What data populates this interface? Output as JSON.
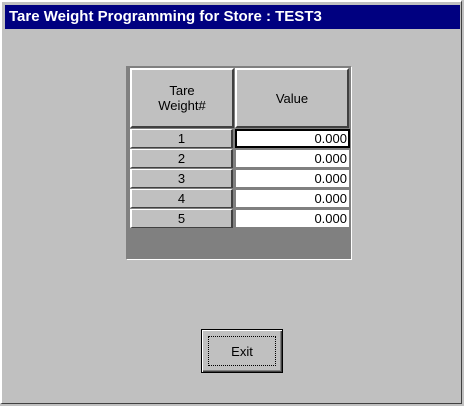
{
  "window": {
    "title": "Tare Weight Programming for Store :  TEST3"
  },
  "grid": {
    "columns": [
      "Tare\nWeight#",
      "Value"
    ],
    "rows": [
      {
        "num": "1",
        "value": "0.000"
      },
      {
        "num": "2",
        "value": "0.000"
      },
      {
        "num": "3",
        "value": "0.000"
      },
      {
        "num": "4",
        "value": "0.000"
      },
      {
        "num": "5",
        "value": "0.000"
      }
    ]
  },
  "buttons": {
    "exit_label": "Exit"
  },
  "colors": {
    "titlebar": "#000080",
    "face": "#c0c0c0"
  }
}
